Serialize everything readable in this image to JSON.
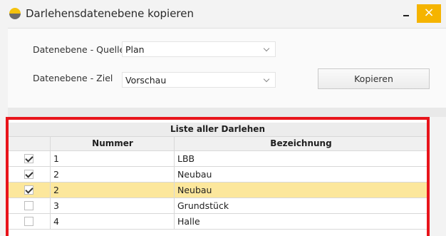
{
  "window": {
    "title": "Darlehensdatenebene kopieren",
    "close_glyph": "×",
    "accent_color": "#f5b400"
  },
  "form": {
    "source_label": "Datenebene - Quelle",
    "source_value": "Plan",
    "target_label": "Datenebene - Ziel",
    "target_value": "Vorschau",
    "copy_button": "Kopieren"
  },
  "grid": {
    "title": "Liste aller Darlehen",
    "columns": [
      "",
      "Nummer",
      "Bezeichnung"
    ],
    "highlight_color": "#e8141b",
    "rows": [
      {
        "checked": true,
        "nummer": "1",
        "bezeichnung": "LBB",
        "selected": false
      },
      {
        "checked": true,
        "nummer": "2",
        "bezeichnung": "Neubau",
        "selected": false
      },
      {
        "checked": true,
        "nummer": "2",
        "bezeichnung": "Neubau",
        "selected": true
      },
      {
        "checked": false,
        "nummer": "3",
        "bezeichnung": "Grundstück",
        "selected": false
      },
      {
        "checked": false,
        "nummer": "4",
        "bezeichnung": "Halle",
        "selected": false
      }
    ]
  }
}
